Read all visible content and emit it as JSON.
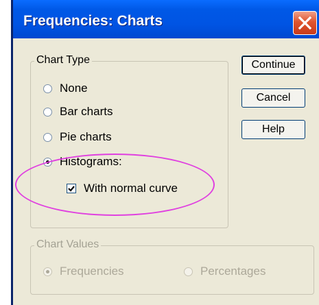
{
  "window": {
    "title": "Frequencies: Charts",
    "close_icon": "close-x-icon"
  },
  "chart_type": {
    "legend": "Chart Type",
    "options": [
      {
        "label": "None",
        "selected": false
      },
      {
        "label": "Bar charts",
        "selected": false
      },
      {
        "label": "Pie charts",
        "selected": false
      },
      {
        "label": "Histograms:",
        "selected": true
      }
    ],
    "normal_curve": {
      "label": "With normal curve",
      "checked": true
    }
  },
  "chart_values": {
    "legend": "Chart Values",
    "enabled": false,
    "options": [
      {
        "label": "Frequencies",
        "selected": true
      },
      {
        "label": "Percentages",
        "selected": false
      }
    ]
  },
  "buttons": {
    "continue": "Continue",
    "cancel": "Cancel",
    "help": "Help"
  },
  "annotation": {
    "color": "#e040e0",
    "shape": "ellipse"
  },
  "colors": {
    "titlebar": "#0054e3",
    "dialog": "#ece9d8"
  }
}
